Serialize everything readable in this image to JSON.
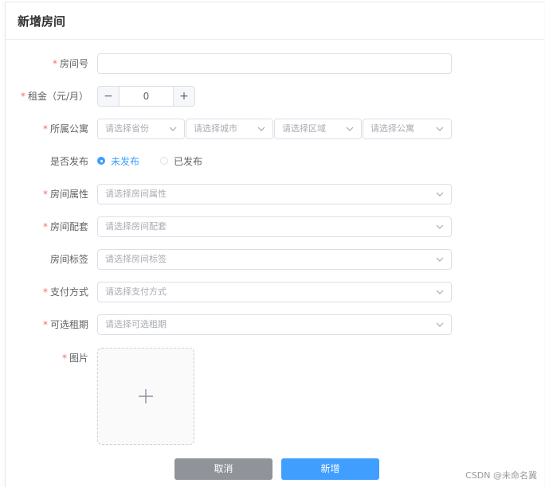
{
  "dialog": {
    "title": "新增房间"
  },
  "form": {
    "room_number": {
      "label": "房间号",
      "value": "",
      "required": true
    },
    "rent": {
      "label": "租金（元/月）",
      "value": "0",
      "minus": "−",
      "plus": "+",
      "required": true
    },
    "apartment": {
      "label": "所属公寓",
      "required": true,
      "selects": [
        "请选择省份",
        "请选择城市",
        "请选择区域",
        "请选择公寓"
      ]
    },
    "publish": {
      "label": "是否发布",
      "required": false,
      "options": [
        {
          "label": "未发布",
          "selected": true
        },
        {
          "label": "已发布",
          "selected": false
        }
      ]
    },
    "attributes": {
      "label": "房间属性",
      "placeholder": "请选择房间属性",
      "required": true
    },
    "facilities": {
      "label": "房间配套",
      "placeholder": "请选择房间配套",
      "required": true
    },
    "tags": {
      "label": "房间标签",
      "placeholder": "请选择房间标签",
      "required": false
    },
    "payment": {
      "label": "支付方式",
      "placeholder": "请选择支付方式",
      "required": true
    },
    "lease_term": {
      "label": "可选租期",
      "placeholder": "请选择可选租期",
      "required": true
    },
    "images": {
      "label": "图片",
      "required": true
    }
  },
  "footer": {
    "cancel_label": "取消",
    "submit_label": "新增"
  },
  "watermark": "CSDN @未命名冀",
  "colors": {
    "primary": "#409eff",
    "required": "#f56c6c",
    "cancel": "#909399"
  },
  "icons": {
    "select_arrow": "chevron-down-icon",
    "upload": "plus-icon"
  }
}
